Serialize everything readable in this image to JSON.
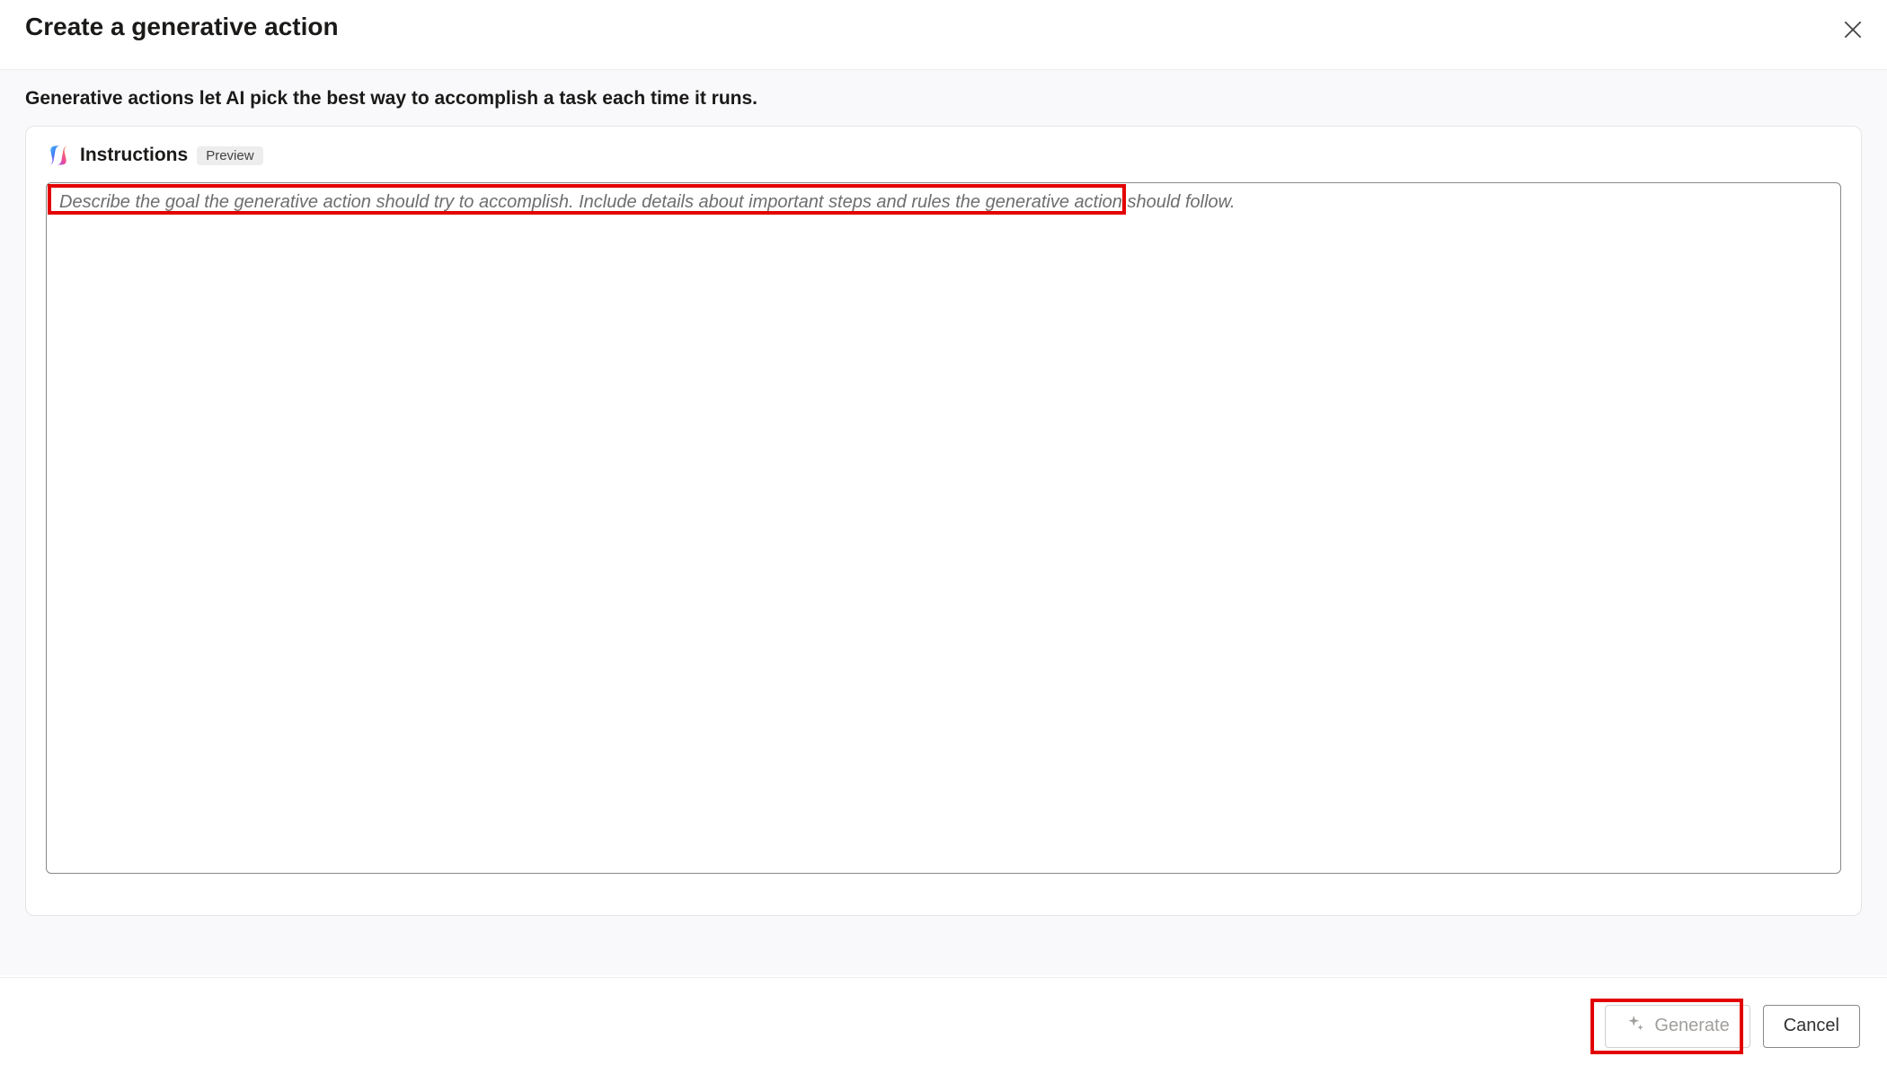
{
  "dialog": {
    "title": "Create a generative action",
    "description": "Generative actions let AI pick the best way to accomplish a task each time it runs."
  },
  "instructions": {
    "label": "Instructions",
    "badge": "Preview",
    "placeholder": "Describe the goal the generative action should try to accomplish. Include details about important steps and rules the generative action should follow.",
    "value": ""
  },
  "footer": {
    "generate": "Generate",
    "cancel": "Cancel"
  }
}
